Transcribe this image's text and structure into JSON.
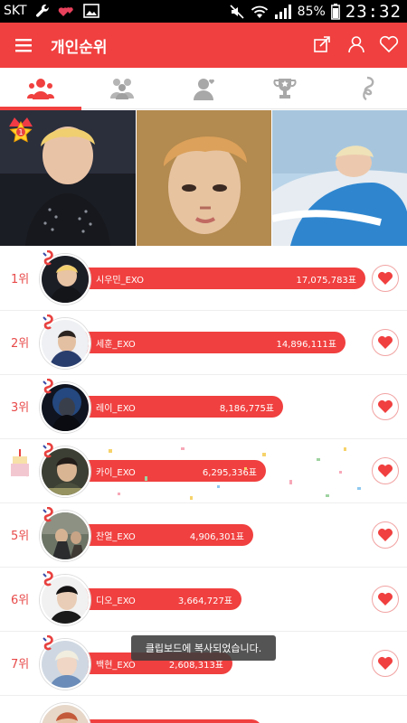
{
  "status_bar": {
    "carrier": "SKT",
    "battery": "85%",
    "time": "23:32"
  },
  "app_bar": {
    "title": "개인순위"
  },
  "colors": {
    "accent": "#f0403f",
    "rank_text": "#e84a4a"
  },
  "tabs": [
    {
      "icon": "person-group-icon",
      "active": true
    },
    {
      "icon": "group-icon",
      "active": false
    },
    {
      "icon": "person-heart-icon",
      "active": false
    },
    {
      "icon": "trophy-icon",
      "active": false
    },
    {
      "icon": "music-note-icon",
      "active": false
    }
  ],
  "top_badge": {
    "number": "1"
  },
  "ranking": [
    {
      "rank": "1위",
      "name": "시우민_EXO",
      "votes": "17,075,783표",
      "bar_fill": 1.0
    },
    {
      "rank": "2위",
      "name": "세훈_EXO",
      "votes": "14,896,111표",
      "bar_fill": 0.872
    },
    {
      "rank": "3위",
      "name": "레이_EXO",
      "votes": "8,186,775표",
      "bar_fill": 0.479
    },
    {
      "rank": "4위",
      "name": "카이_EXO",
      "votes": "6,295,336표",
      "bar_fill": 0.369
    },
    {
      "rank": "5위",
      "name": "찬열_EXO",
      "votes": "4,906,301표",
      "bar_fill": 0.287
    },
    {
      "rank": "6위",
      "name": "디오_EXO",
      "votes": "3,664,727표",
      "bar_fill": 0.215
    },
    {
      "rank": "7위",
      "name": "백현_EXO",
      "votes": "2,608,313표",
      "bar_fill": 0.153
    }
  ],
  "toast": {
    "message": "클립보드에 복사되었습니다."
  }
}
